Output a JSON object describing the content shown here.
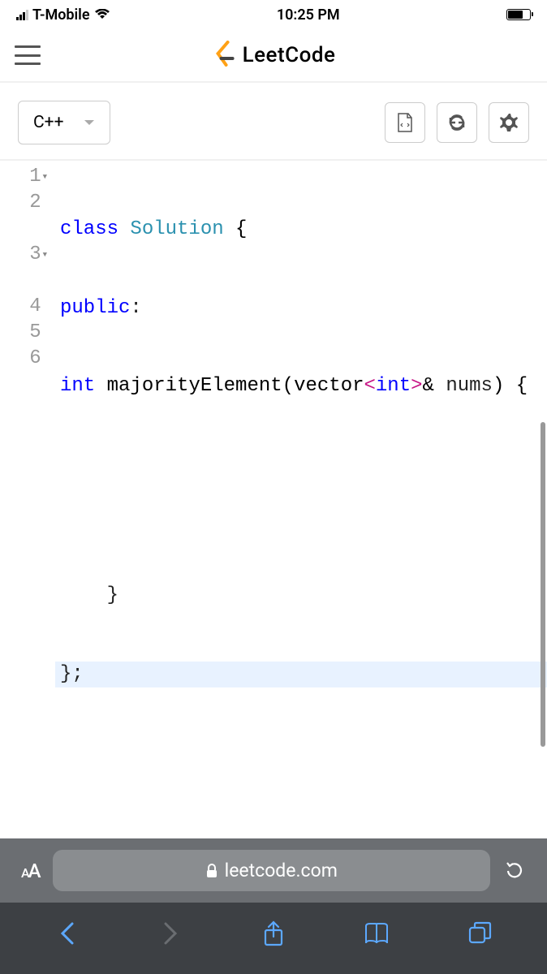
{
  "status_bar": {
    "carrier": "T-Mobile",
    "time": "10:25 PM"
  },
  "header": {
    "brand": "LeetCode"
  },
  "toolbar": {
    "language": "C++"
  },
  "code": {
    "line1_num": "1",
    "line2_num": "2",
    "line3_num": "3",
    "line4_num": "4",
    "line5_num": "5",
    "line6_num": "6",
    "line1_kw": "class",
    "line1_name": "Solution",
    "line1_brace": "{",
    "line2_kw": "public",
    "line2_colon": ":",
    "line3_type": "int",
    "line3_method": "majorityElement",
    "line3_vector": "vector",
    "line3_int": "int",
    "line3_param": "nums",
    "line4": "",
    "line5": "    }",
    "line6": "};"
  },
  "browser": {
    "aa": "AA",
    "url": "leetcode.com"
  }
}
